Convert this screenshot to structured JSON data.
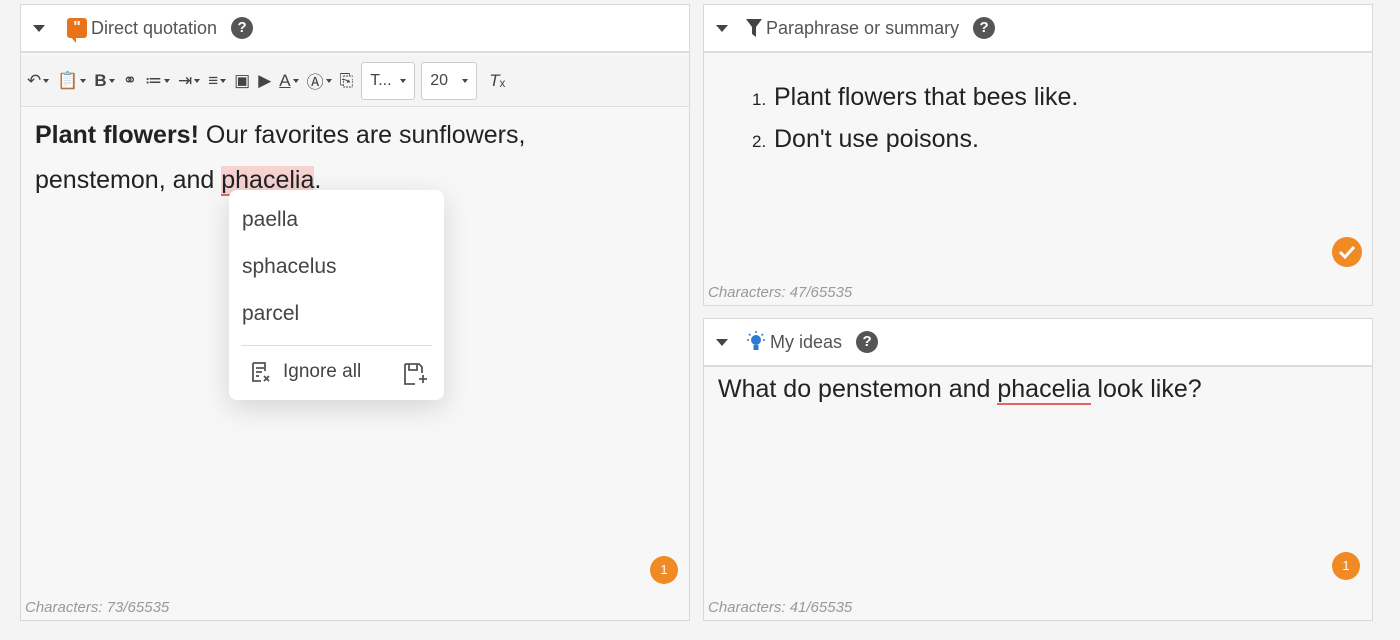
{
  "direct_quotation": {
    "title": "Direct quotation",
    "help": "?",
    "toolbar": {
      "style_select": "T...",
      "size_select": "20"
    },
    "text": {
      "bold": "Plant flowers!",
      "part1": " Our favorites are sunflowers,",
      "part2": "penstemon, and ",
      "misspelled": "phacelia",
      "end": "."
    },
    "counter": "Characters: 73/65535",
    "badge": "1"
  },
  "spell_popup": {
    "suggestions": [
      "paella",
      "sphacelus",
      "parcel"
    ],
    "ignore_all": "Ignore all"
  },
  "paraphrase": {
    "title": "Paraphrase or summary",
    "help": "?",
    "items": [
      {
        "num": "1.",
        "text": "Plant flowers that bees like."
      },
      {
        "num": "2.",
        "text": "Don't use poisons."
      }
    ],
    "counter": "Characters: 47/65535"
  },
  "my_ideas": {
    "title": "My ideas",
    "help": "?",
    "text": {
      "before": "What do penstemon and ",
      "misspelled": "phacelia",
      "after": " look like?"
    },
    "counter": "Characters: 41/65535",
    "badge": "1"
  },
  "colors": {
    "accent": "#f08a24",
    "spellcheck": "#e06666"
  }
}
